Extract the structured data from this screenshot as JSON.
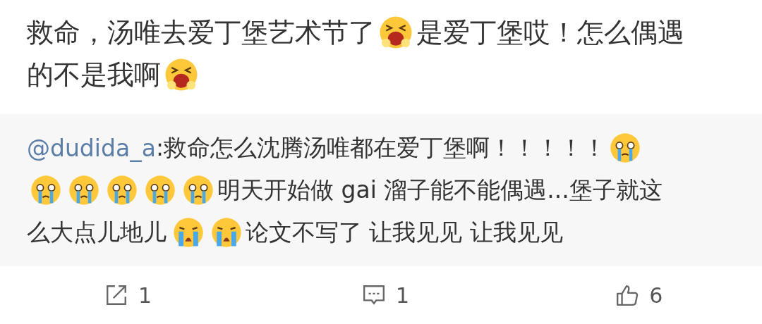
{
  "post": {
    "lines": [
      [
        {
          "kind": "text",
          "text": "救命，汤唯去爱丁堡艺术节了"
        },
        {
          "kind": "yell"
        },
        {
          "kind": "text",
          "text": "是爱丁堡哎！怎么偶遇"
        }
      ],
      [
        {
          "kind": "text",
          "text": "的不是我啊"
        },
        {
          "kind": "yell"
        }
      ]
    ]
  },
  "reply": {
    "lines": [
      [
        {
          "kind": "user",
          "text": "@dudida_a"
        },
        {
          "kind": "text",
          "text": ":救命怎么沈腾汤唯都在爱丁堡啊！！！！！"
        },
        {
          "kind": "tears"
        }
      ],
      [
        {
          "kind": "tears"
        },
        {
          "kind": "tears"
        },
        {
          "kind": "tears"
        },
        {
          "kind": "tears"
        },
        {
          "kind": "tears"
        },
        {
          "kind": "text",
          "text": "明天开始做 gai 溜子能不能偶遇...堡子就这"
        }
      ],
      [
        {
          "kind": "text",
          "text": "么大点儿地儿"
        },
        {
          "kind": "sob"
        },
        {
          "kind": "sob"
        },
        {
          "kind": "text",
          "text": "论文不写了 让我见见 让我见见"
        }
      ]
    ]
  },
  "actions": [
    {
      "kind": "repost",
      "count": "1"
    },
    {
      "kind": "comment",
      "count": "1"
    },
    {
      "kind": "like",
      "count": "6"
    }
  ]
}
